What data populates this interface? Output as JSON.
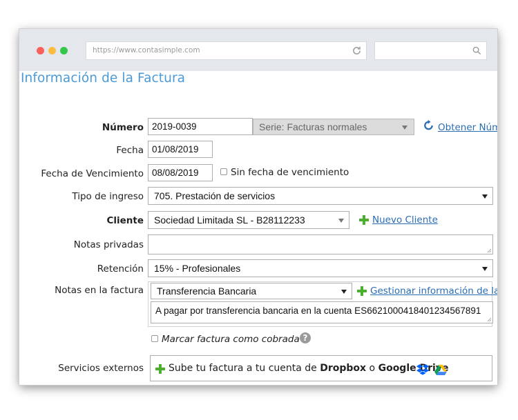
{
  "browser": {
    "url": "https://www.contasimple.com"
  },
  "page": {
    "title": "Información de la Factura"
  },
  "form": {
    "numero": {
      "label": "Número",
      "value": "2019-0039",
      "serie": "Serie: Facturas normales",
      "action_link": "Obtener Núm"
    },
    "fecha": {
      "label": "Fecha",
      "value": "01/08/2019"
    },
    "vencimiento": {
      "label": "Fecha de Vencimiento",
      "value": "08/08/2019",
      "checkbox_label": "Sin fecha de vencimiento"
    },
    "tipo_ingreso": {
      "label": "Tipo de ingreso",
      "value": "705. Prestación de servicios"
    },
    "cliente": {
      "label": "Cliente",
      "value": "Sociedad Limitada SL - B28112233",
      "new_link": "Nuevo Cliente"
    },
    "notas_privadas": {
      "label": "Notas privadas",
      "value": ""
    },
    "retencion": {
      "label": "Retención",
      "value": "15% - Profesionales"
    },
    "notas_factura": {
      "label": "Notas en la factura",
      "payment_method": "Transferencia Bancaria",
      "manage_link": "Gestionar información de la f",
      "note_text": "A pagar por transferencia bancaria en la cuenta ES6621000418401234567891"
    },
    "cobrada": {
      "checkbox_label": "Marcar factura como cobrada",
      "help": "?"
    },
    "servicios_externos": {
      "label": "Servicios externos",
      "text_prefix": "Sube tu factura a tu cuenta de",
      "dropbox": "Dropbox",
      "connector": "o",
      "gdrive": "Google Drive"
    }
  },
  "colors": {
    "title": "#4b9ad7",
    "link": "#2a6db5",
    "plus": "#4caf2f",
    "dropbox": "#0061fe"
  },
  "icons": [
    "reload-icon",
    "search-icon",
    "refresh-icon",
    "plus-icon",
    "help-icon",
    "dropbox-icon",
    "google-drive-icon",
    "chevron-down-icon"
  ]
}
